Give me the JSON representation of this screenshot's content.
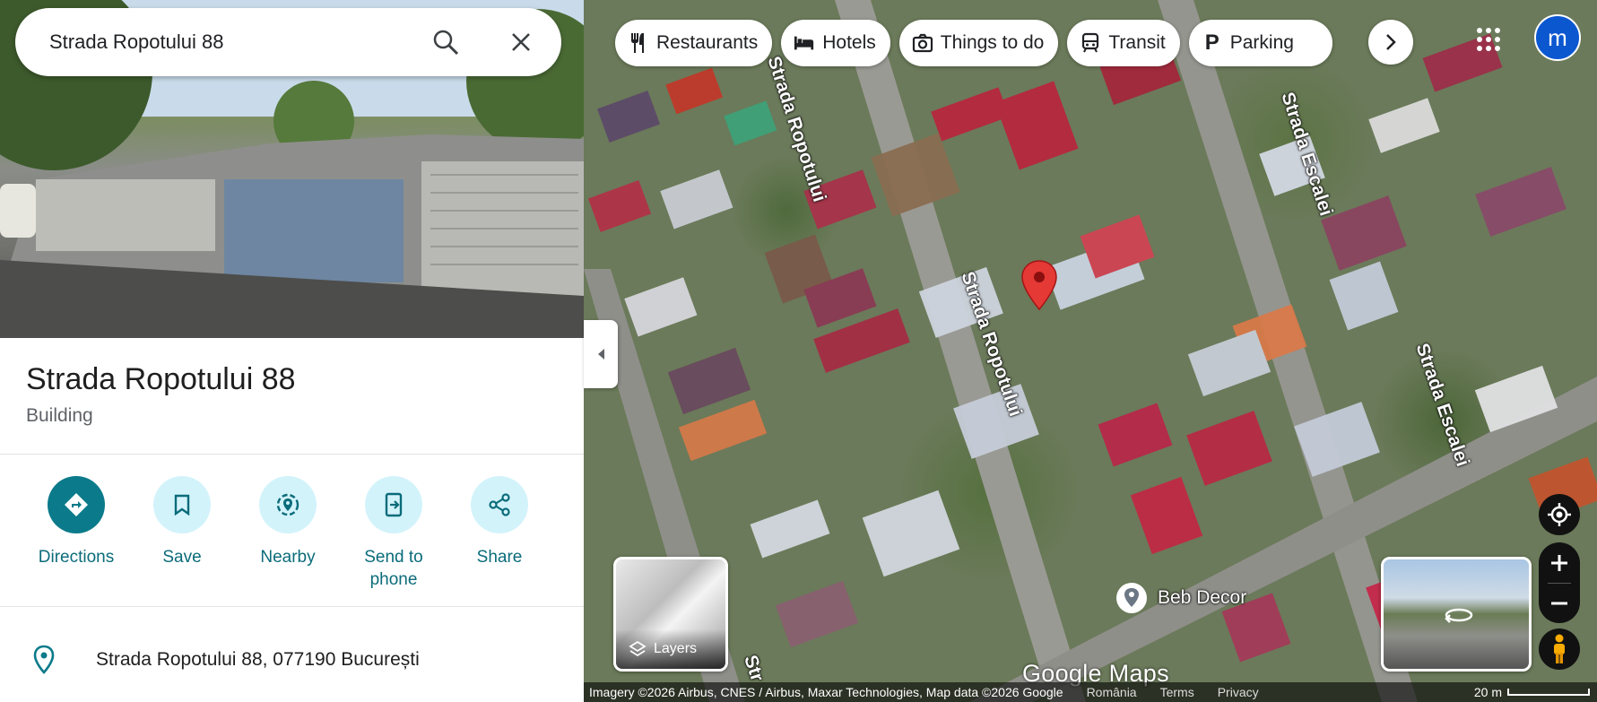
{
  "search": {
    "value": "Strada Ropotului 88"
  },
  "place": {
    "title": "Strada Ropotului 88",
    "category": "Building",
    "address": "Strada Ropotului 88, 077190 București"
  },
  "actions": [
    {
      "label": "Directions"
    },
    {
      "label": "Save"
    },
    {
      "label": "Nearby"
    },
    {
      "label": "Send to\nphone"
    },
    {
      "label": "Share"
    }
  ],
  "chips": [
    {
      "label": "Restaurants",
      "icon": "fork-knife-icon"
    },
    {
      "label": "Hotels",
      "icon": "bed-icon"
    },
    {
      "label": "Things to do",
      "icon": "camera-icon"
    },
    {
      "label": "Transit",
      "icon": "train-icon"
    },
    {
      "label": "Parking",
      "icon": "parking-icon"
    }
  ],
  "account": {
    "initial": "m",
    "color": "#0b57d0"
  },
  "streets": {
    "ropotului": "Strada Ropotului",
    "escalei": "Strada Escalei",
    "partial": "Str"
  },
  "poi": {
    "label": "Beb Decor"
  },
  "layers": {
    "label": "Layers"
  },
  "logo": "Google Maps",
  "footer": {
    "attribution": "Imagery ©2026 Airbus, CNES / Airbus, Maxar Technologies, Map data ©2026 Google",
    "links": [
      "România",
      "Terms",
      "Privacy"
    ],
    "scale": "20 m"
  },
  "colors": {
    "accent": "#0b7a8a",
    "action_bg": "#d3f3fb",
    "pin": "#e53935"
  }
}
